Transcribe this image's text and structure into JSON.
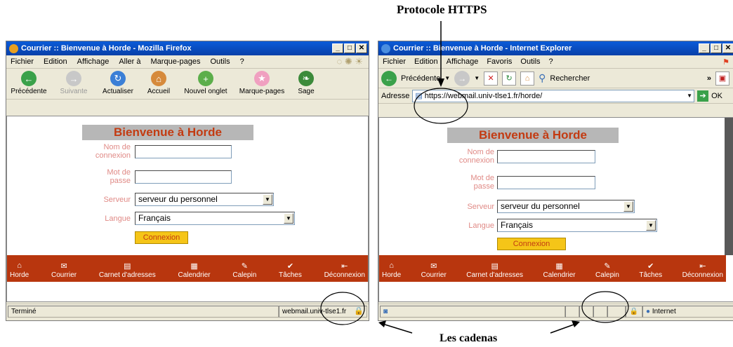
{
  "annotations": {
    "https_label": "Protocole HTTPS",
    "padlocks_label": "Les cadenas"
  },
  "firefox": {
    "title": "Courrier :: Bienvenue à Horde - Mozilla Firefox",
    "menu": [
      "Fichier",
      "Edition",
      "Affichage",
      "Aller à",
      "Marque-pages",
      "Outils",
      "?"
    ],
    "toolbar": [
      {
        "label": "Précédente",
        "icon": "back-arrow-icon",
        "color": "#3aa14a",
        "glyph": "←",
        "disabled": false
      },
      {
        "label": "Suivante",
        "icon": "forward-arrow-icon",
        "color": "#b8b8b8",
        "glyph": "→",
        "disabled": true
      },
      {
        "label": "Actualiser",
        "icon": "reload-icon",
        "color": "#3b7fd6",
        "glyph": "↻",
        "disabled": false
      },
      {
        "label": "Accueil",
        "icon": "home-icon",
        "color": "#d68a3b",
        "glyph": "⌂",
        "disabled": false
      },
      {
        "label": "Nouvel onglet",
        "icon": "new-tab-icon",
        "color": "#5cae4a",
        "glyph": "+",
        "disabled": false
      },
      {
        "label": "Marque-pages",
        "icon": "star-icon",
        "color": "#f0a0c0",
        "glyph": "★",
        "disabled": false
      },
      {
        "label": "Sage",
        "icon": "sage-leaf-icon",
        "color": "#3c8a3a",
        "glyph": "❧",
        "disabled": false
      }
    ],
    "status_text": "Terminé",
    "status_url": "webmail.univ-tlse1.fr"
  },
  "ie": {
    "title": "Courrier :: Bienvenue à Horde - Internet Explorer",
    "menu": [
      "Fichier",
      "Edition",
      "Affichage",
      "Favoris",
      "Outils",
      "?"
    ],
    "back_label": "Précédente",
    "search_label": "Rechercher",
    "address_label": "Adresse",
    "address_value": "https://webmail.univ-tlse1.fr/horde/",
    "go_label": "OK",
    "status_zone": "Internet"
  },
  "horde": {
    "title": "Bienvenue à Horde",
    "login_label_1": "Nom de",
    "login_label_2": "connexion",
    "password_label_1": "Mot de",
    "password_label_2": "passe",
    "server_label": "Serveur",
    "server_value": "serveur du personnel",
    "language_label": "Langue",
    "language_value": "Français",
    "connect_button": "Connexion",
    "nav": [
      "Horde",
      "Courrier",
      "Carnet d'adresses",
      "Calendrier",
      "Calepin",
      "Tâches",
      "Déconnexion"
    ],
    "nav_glyphs": [
      "⌂",
      "✉",
      "▤",
      "▦",
      "✎",
      "✔",
      "⇤"
    ]
  },
  "colors": {
    "header_text": "#c33b12",
    "nav_bg": "#b8360e",
    "label_text": "#e08a86",
    "button_bg": "#f5c518"
  }
}
